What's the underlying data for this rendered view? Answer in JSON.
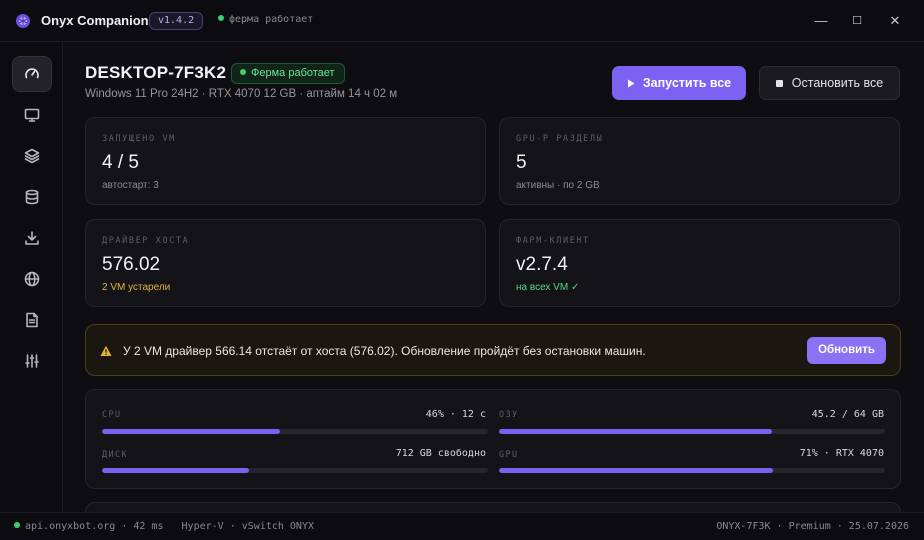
{
  "app": {
    "name": "Onyx Companion",
    "version": "v1.4.2",
    "farm_status": "ферма работает"
  },
  "window_controls": {
    "minimize": "—",
    "maximize": "☐",
    "close": "✕"
  },
  "sidebar": {
    "items": [
      {
        "icon": "dashboard-gauge-icon",
        "active": true
      },
      {
        "icon": "monitor-icon",
        "active": false
      },
      {
        "icon": "layers-icon",
        "active": false
      },
      {
        "icon": "database-icon",
        "active": false
      },
      {
        "icon": "download-icon",
        "active": false
      },
      {
        "icon": "globe-icon",
        "active": false
      },
      {
        "icon": "document-icon",
        "active": false
      },
      {
        "icon": "sliders-icon",
        "active": false
      }
    ]
  },
  "header": {
    "host_name": "DESKTOP-7F3K2",
    "badge": "Ферма работает",
    "meta": "Windows 11 Pro 24H2 · RTX 4070 12 GB · аптайм 14 ч 02 м",
    "start_all": "Запустить все",
    "stop_all": "Остановить все"
  },
  "cards": {
    "vms": {
      "label": "ЗАПУЩЕНО VM",
      "value": "4 / 5",
      "sub": "автостарт: 3"
    },
    "gpu": {
      "label": "GPU-P РАЗДЕЛЫ",
      "value": "5",
      "sub": "активны · по 2 GB"
    },
    "driver": {
      "label": "ДРАЙВЕР ХОСТА",
      "value": "576.02",
      "sub": "2 VM устарели"
    },
    "client": {
      "label": "ФАРМ-КЛИЕНТ",
      "value": "v2.7.4",
      "sub": "на всех VM ✓"
    }
  },
  "colors": {
    "accent": "#7b62f2",
    "ok": "#3ecf6b",
    "warn": "#e6b43c"
  },
  "alert": {
    "text": "У 2 VM драйвер 566.14 отстаёт от хоста (576.02). Обновление пройдёт без остановки машин.",
    "button": "Обновить"
  },
  "metrics": {
    "cpu": {
      "label": "CPU",
      "value": "46% · 12 с",
      "fraction": 0.46
    },
    "ram": {
      "label": "ОЗУ",
      "value": "45.2 / 64 GB",
      "fraction": 0.706
    },
    "disk": {
      "label": "ДИСК",
      "value": "712 GB свободно",
      "fraction": 0.38
    },
    "gpu": {
      "label": "GPU",
      "value": "71% · RTX 4070",
      "fraction": 0.71
    }
  },
  "statusbar": {
    "left": "api.onyxbot.org · 42 ms   Hyper-V · vSwitch ONYX",
    "right": "ONYX-7F3K · Premium · 25.07.2026"
  }
}
